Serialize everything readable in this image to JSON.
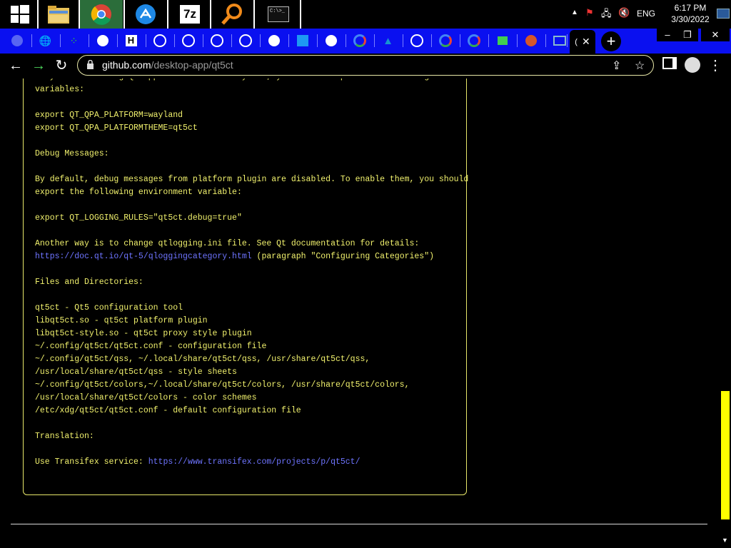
{
  "taskbar": {
    "apps": [
      {
        "name": "start-button"
      },
      {
        "name": "file-explorer"
      },
      {
        "name": "chrome",
        "active": true
      },
      {
        "name": "kde-connect"
      },
      {
        "name": "7zip",
        "label": "7z"
      },
      {
        "name": "search-tool"
      },
      {
        "name": "command-prompt",
        "label": "C:\\>_"
      }
    ],
    "tray": {
      "language": "ENG",
      "time": "6:17 PM",
      "date": "3/30/2022"
    }
  },
  "browser": {
    "tabs": [
      "discord",
      "globe",
      "grid",
      "github",
      "h",
      "chrome",
      "chrome",
      "chrome",
      "chrome",
      "github",
      "kde",
      "github",
      "google",
      "arch",
      "chrome",
      "google",
      "google",
      "qt",
      "ask",
      "monitor",
      "current"
    ],
    "new_tab_label": "+",
    "window_controls": [
      "–",
      "❐",
      "✕"
    ],
    "address": {
      "domain": "github.com",
      "path": "/desktop-app/qt5ct"
    }
  },
  "readme": {
    "lines": [
      {
        "text": "If you are running Qt application under Wayland, you should export the following"
      },
      {
        "text": "variables:"
      },
      {
        "text": ""
      },
      {
        "text": "export QT_QPA_PLATFORM=wayland"
      },
      {
        "text": "export QT_QPA_PLATFORMTHEME=qt5ct"
      },
      {
        "text": ""
      },
      {
        "text": "Debug Messages:"
      },
      {
        "text": ""
      },
      {
        "text": "By default, debug messages from platform plugin are disabled. To enable them, you should"
      },
      {
        "text": "export the following environment variable:"
      },
      {
        "text": ""
      },
      {
        "text": "export QT_LOGGING_RULES=\"qt5ct.debug=true\""
      },
      {
        "text": ""
      },
      {
        "text": "Another way is to change qtlogging.ini file. See Qt documentation for details:"
      },
      {
        "link": "https://doc.qt.io/qt-5/qloggingcategory.html",
        "text": " (paragraph \"Configuring Categories\")"
      },
      {
        "text": ""
      },
      {
        "text": "Files and Directories:"
      },
      {
        "text": ""
      },
      {
        "text": "qt5ct - Qt5 configuration tool"
      },
      {
        "text": "libqt5ct.so - qt5ct platform plugin"
      },
      {
        "text": "libqt5ct-style.so - qt5ct proxy style plugin"
      },
      {
        "text": "~/.config/qt5ct/qt5ct.conf - configuration file"
      },
      {
        "text": "~/.config/qt5ct/qss, ~/.local/share/qt5ct/qss, /usr/share/qt5ct/qss,"
      },
      {
        "text": "/usr/local/share/qt5ct/qss - style sheets"
      },
      {
        "text": "~/.config/qt5ct/colors,~/.local/share/qt5ct/colors, /usr/share/qt5ct/colors,"
      },
      {
        "text": "/usr/local/share/qt5ct/colors - color schemes"
      },
      {
        "text": "/etc/xdg/qt5ct/qt5ct.conf - default configuration file"
      },
      {
        "text": ""
      },
      {
        "text": "Translation:"
      },
      {
        "text": ""
      },
      {
        "text": "Use Transifex service: ",
        "link": "https://www.transifex.com/projects/p/qt5ct/",
        "link_after": true
      }
    ]
  },
  "scrollbar": {
    "position_fraction": 0.72
  },
  "colors": {
    "readme_text": "#f1f16d",
    "link": "#6e74ff",
    "tabstrip": "#0a10f0",
    "scroll_thumb": "#ffff00"
  }
}
